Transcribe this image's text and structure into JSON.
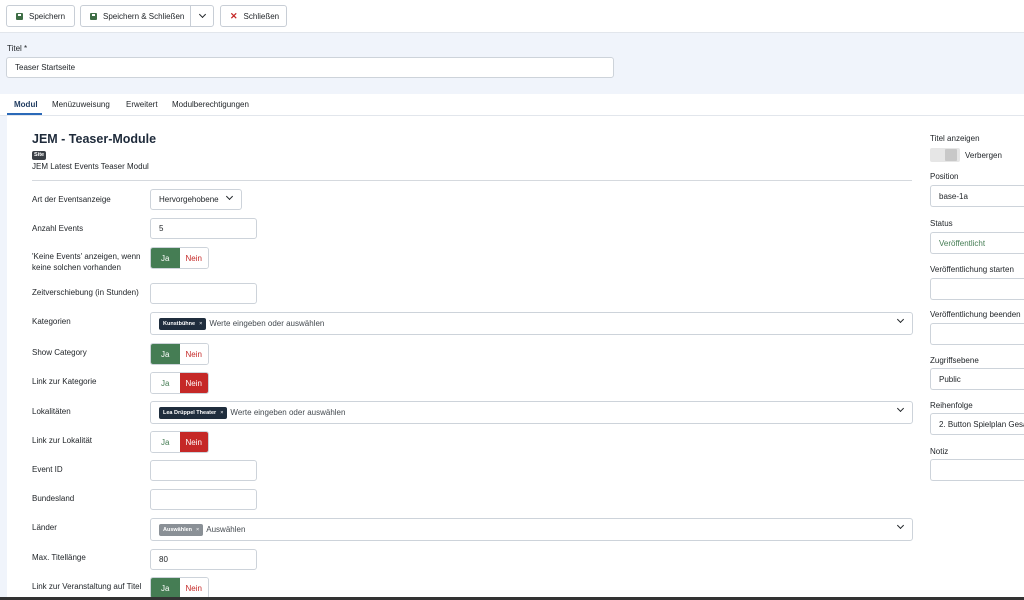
{
  "toolbar": {
    "save_label": "Speichern",
    "save_close_label": "Speichern & Schließen",
    "close_label": "Schließen"
  },
  "title_field": {
    "label": "Titel *",
    "value": "Teaser Startseite"
  },
  "tabs": [
    {
      "label": "Modul"
    },
    {
      "label": "Menüzuweisung"
    },
    {
      "label": "Erweitert"
    },
    {
      "label": "Modulberechtigungen"
    }
  ],
  "module": {
    "title": "JEM - Teaser-Module",
    "badge": "Site",
    "subtitle": "JEM Latest Events Teaser Modul"
  },
  "fields": {
    "art": {
      "label": "Art der Eventsanzeige",
      "value": "Hervorgehobene"
    },
    "anzahl": {
      "label": "Anzahl Events",
      "value": "5"
    },
    "keine": {
      "label": "'Keine Events' anzeigen, wenn keine solchen vorhanden"
    },
    "zeit": {
      "label": "Zeitverschiebung (in Stunden)",
      "value": ""
    },
    "kategorien": {
      "label": "Kategorien",
      "chip": "Kunstbühne",
      "placeholder": "Werte eingeben oder auswählen"
    },
    "show_category": {
      "label": "Show Category"
    },
    "link_kategorie": {
      "label": "Link zur Kategorie"
    },
    "lokalitaeten": {
      "label": "Lokalitäten",
      "chip": "Lea Drüppel Theater",
      "placeholder": "Werte eingeben oder auswählen"
    },
    "link_lokalitaet": {
      "label": "Link zur Lokalität"
    },
    "event_id": {
      "label": "Event ID",
      "value": ""
    },
    "bundesland": {
      "label": "Bundesland",
      "value": ""
    },
    "laender": {
      "label": "Länder",
      "chip": "Auswählen",
      "placeholder": "Auswählen"
    },
    "max_titel": {
      "label": "Max. Titellänge",
      "value": "80"
    },
    "link_veranstaltung": {
      "label": "Link zur Veranstaltung auf Titel"
    }
  },
  "toggle_labels": {
    "yes": "Ja",
    "no": "Nein"
  },
  "sidebar": {
    "titel_anzeigen": {
      "label": "Titel anzeigen",
      "value": "Verbergen"
    },
    "position": {
      "label": "Position",
      "value": "base-1a"
    },
    "status": {
      "label": "Status",
      "value": "Veröffentlicht"
    },
    "start": {
      "label": "Veröffentlichung starten",
      "value": ""
    },
    "ende": {
      "label": "Veröffentlichung beenden",
      "value": ""
    },
    "zugriff": {
      "label": "Zugriffsebene",
      "value": "Public"
    },
    "reihenfolge": {
      "label": "Reihenfolge",
      "value": "2. Button Spielplan Gesa"
    },
    "notiz": {
      "label": "Notiz",
      "value": ""
    }
  },
  "colors": {
    "accent": "#457d54",
    "danger": "#c52827",
    "tab_active": "#2a69b8"
  }
}
